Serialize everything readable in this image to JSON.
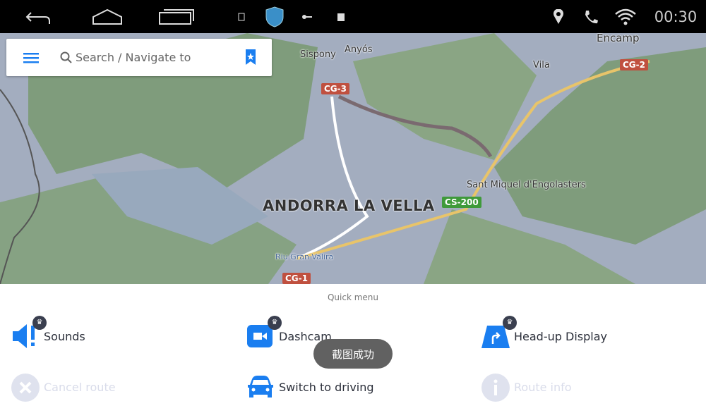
{
  "status_bar": {
    "time": "00:30",
    "icons": [
      "back-icon",
      "home-icon",
      "recents-icon",
      "image-icon",
      "vpn-shield-icon",
      "key-icon",
      "clipboard-check-icon",
      "location-pin-icon",
      "phone-icon",
      "wifi-icon"
    ]
  },
  "search": {
    "placeholder": "Search / Navigate to",
    "icons": [
      "menu-icon",
      "search-icon",
      "bookmark-star-icon"
    ]
  },
  "map": {
    "places": [
      "Sispony",
      "Anyós",
      "Encamp",
      "Vila",
      "Sant Miquel d'Engolasters",
      "ANDORRA LA VELLA",
      "Riu Gran Valira"
    ],
    "roads": [
      {
        "label": "CG-3",
        "color": "#c0503f"
      },
      {
        "label": "CG-2",
        "color": "#c0503f"
      },
      {
        "label": "CS-200",
        "color": "#3f9a3a"
      },
      {
        "label": "CG-1",
        "color": "#c0503f"
      }
    ]
  },
  "quick_menu": {
    "title": "Quick menu",
    "items": [
      {
        "label": "Sounds",
        "premium": true,
        "enabled": true
      },
      {
        "label": "Dashcam",
        "premium": true,
        "enabled": true
      },
      {
        "label": "Head-up Display",
        "premium": true,
        "enabled": true
      },
      {
        "label": "Cancel route",
        "premium": false,
        "enabled": false
      },
      {
        "label": "Switch to driving",
        "premium": false,
        "enabled": true
      },
      {
        "label": "Route info",
        "premium": false,
        "enabled": false
      }
    ]
  },
  "toast": "截图成功",
  "colors": {
    "accent": "#1a7ef0",
    "disabled": "#dfe2ee",
    "crown_badge": "#3a3f4f"
  }
}
